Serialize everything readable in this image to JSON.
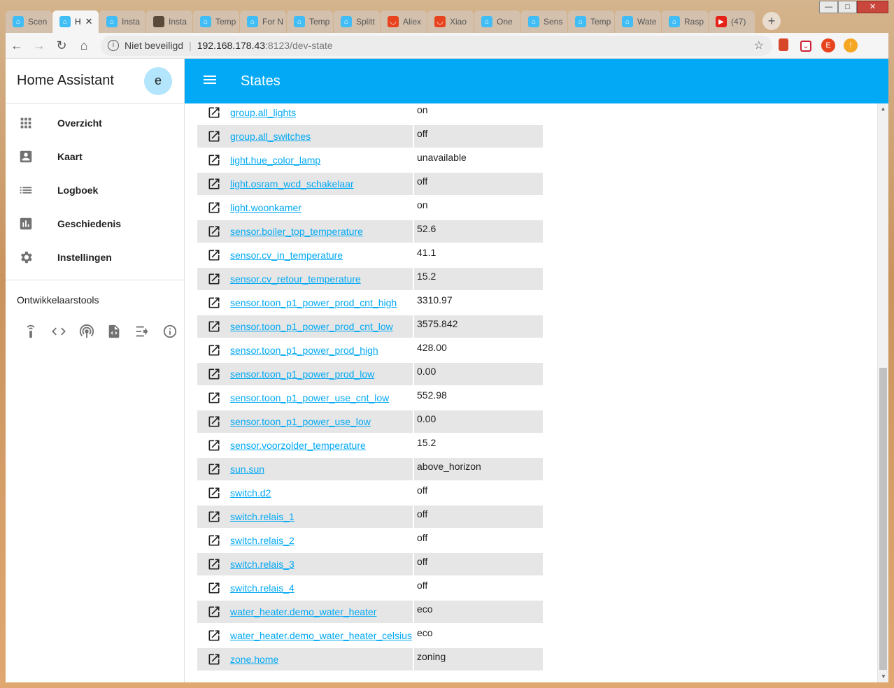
{
  "browser": {
    "tabs": [
      {
        "label": "Scen",
        "icon": "home-assistant-icon"
      },
      {
        "label": "H",
        "icon": "home-assistant-icon",
        "active": true
      },
      {
        "label": "Insta",
        "icon": "home-assistant-icon"
      },
      {
        "label": "Insta",
        "icon": "photo-icon"
      },
      {
        "label": "Temp",
        "icon": "home-assistant-icon"
      },
      {
        "label": "For N",
        "icon": "home-assistant-icon"
      },
      {
        "label": "Temp",
        "icon": "home-assistant-icon"
      },
      {
        "label": "Splitt",
        "icon": "home-assistant-icon"
      },
      {
        "label": "Aliex",
        "icon": "aliexpress-icon"
      },
      {
        "label": "Xiao",
        "icon": "aliexpress-icon"
      },
      {
        "label": "One",
        "icon": "home-assistant-icon"
      },
      {
        "label": "Sens",
        "icon": "home-assistant-icon"
      },
      {
        "label": "Temp",
        "icon": "home-assistant-icon"
      },
      {
        "label": "Wate",
        "icon": "home-assistant-icon"
      },
      {
        "label": "Rasp",
        "icon": "home-assistant-icon"
      },
      {
        "label": "(47)",
        "icon": "youtube-icon"
      }
    ],
    "security_label": "Niet beveiligd",
    "url_host": "192.168.178.43",
    "url_path": ":8123/dev-state",
    "profile_initial": "E"
  },
  "sidebar": {
    "title": "Home Assistant",
    "avatar_initial": "e",
    "items": [
      {
        "label": "Overzicht",
        "icon": "apps-grid-icon"
      },
      {
        "label": "Kaart",
        "icon": "account-box-icon"
      },
      {
        "label": "Logboek",
        "icon": "list-icon"
      },
      {
        "label": "Geschiedenis",
        "icon": "chart-bar-icon"
      },
      {
        "label": "Instellingen",
        "icon": "settings-icon"
      }
    ],
    "dev_tools_title": "Ontwikkelaarstools",
    "dev_tools": [
      "remote-icon",
      "code-icon",
      "mqtt-icon",
      "file-code-icon",
      "logs-icon",
      "info-icon"
    ]
  },
  "header": {
    "title": "States"
  },
  "states": [
    {
      "entity": "group.all_lights",
      "state": "on"
    },
    {
      "entity": "group.all_switches",
      "state": "off"
    },
    {
      "entity": "light.hue_color_lamp",
      "state": "unavailable"
    },
    {
      "entity": "light.osram_wcd_schakelaar",
      "state": "off"
    },
    {
      "entity": "light.woonkamer",
      "state": "on"
    },
    {
      "entity": "sensor.boiler_top_temperature",
      "state": "52.6"
    },
    {
      "entity": "sensor.cv_in_temperature",
      "state": "41.1"
    },
    {
      "entity": "sensor.cv_retour_temperature",
      "state": "15.2"
    },
    {
      "entity": "sensor.toon_p1_power_prod_cnt_high",
      "state": "3310.97"
    },
    {
      "entity": "sensor.toon_p1_power_prod_cnt_low",
      "state": "3575.842"
    },
    {
      "entity": "sensor.toon_p1_power_prod_high",
      "state": "428.00"
    },
    {
      "entity": "sensor.toon_p1_power_prod_low",
      "state": "0.00"
    },
    {
      "entity": "sensor.toon_p1_power_use_cnt_low",
      "state": "552.98"
    },
    {
      "entity": "sensor.toon_p1_power_use_low",
      "state": "0.00"
    },
    {
      "entity": "sensor.voorzolder_temperature",
      "state": "15.2"
    },
    {
      "entity": "sun.sun",
      "state": "above_horizon"
    },
    {
      "entity": "switch.d2",
      "state": "off"
    },
    {
      "entity": "switch.relais_1",
      "state": "off"
    },
    {
      "entity": "switch.relais_2",
      "state": "off"
    },
    {
      "entity": "switch.relais_3",
      "state": "off"
    },
    {
      "entity": "switch.relais_4",
      "state": "off"
    },
    {
      "entity": "water_heater.demo_water_heater",
      "state": "eco"
    },
    {
      "entity": "water_heater.demo_water_heater_celsius",
      "state": "eco"
    },
    {
      "entity": "zone.home",
      "state": "zoning"
    }
  ],
  "colors": {
    "accent": "#03a9f4",
    "avatar_bg": "#b3e5fc",
    "row_shade": "#e6e6e6"
  }
}
